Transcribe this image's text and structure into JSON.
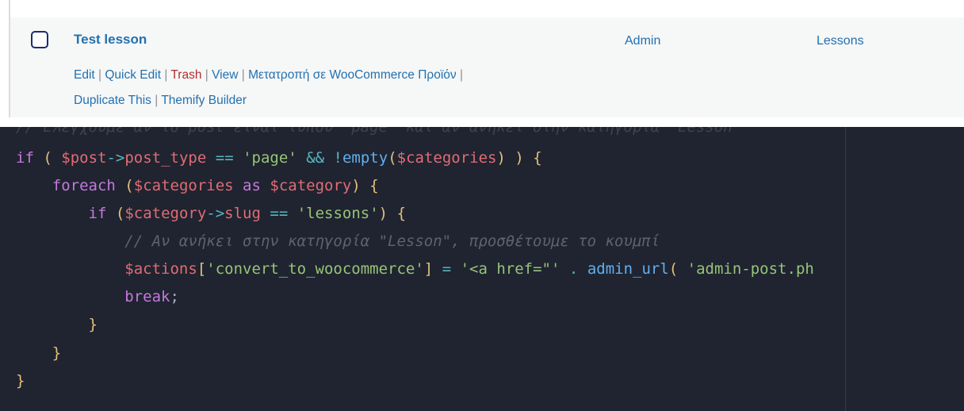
{
  "wp_list": {
    "title": "Test lesson",
    "author": "Admin",
    "category": "Lessons",
    "actions": {
      "edit": "Edit",
      "quick_edit": "Quick Edit",
      "trash": "Trash",
      "view": "View",
      "convert": "Μετατροπή σε WooCommerce Προϊόν",
      "duplicate": "Duplicate This",
      "themify": "Themify Builder",
      "separator": "|"
    },
    "colors": {
      "link": "#2271b1",
      "trash": "#b32d2e",
      "row_bg": "#f6f7f7"
    }
  },
  "code_editor": {
    "theme_background": "#1f2430",
    "lines": [
      "// Ελέγχουμε αν το post είναι τύπου \"page\" και αν ανήκει στην κατηγορία \"Lesson\"",
      "if ( $post->post_type == 'page' && !empty($categories) ) {",
      "    foreach ($categories as $category) {",
      "        if ($category->slug == 'lessons') {",
      "            // Αν ανήκει στην κατηγορία \"Lesson\", προσθέτουμε το κουμπί",
      "            $actions['convert_to_woocommerce'] = '<a href=\"' . admin_url( 'admin-post.ph",
      "            break;",
      "        }",
      "    }",
      "}"
    ]
  }
}
